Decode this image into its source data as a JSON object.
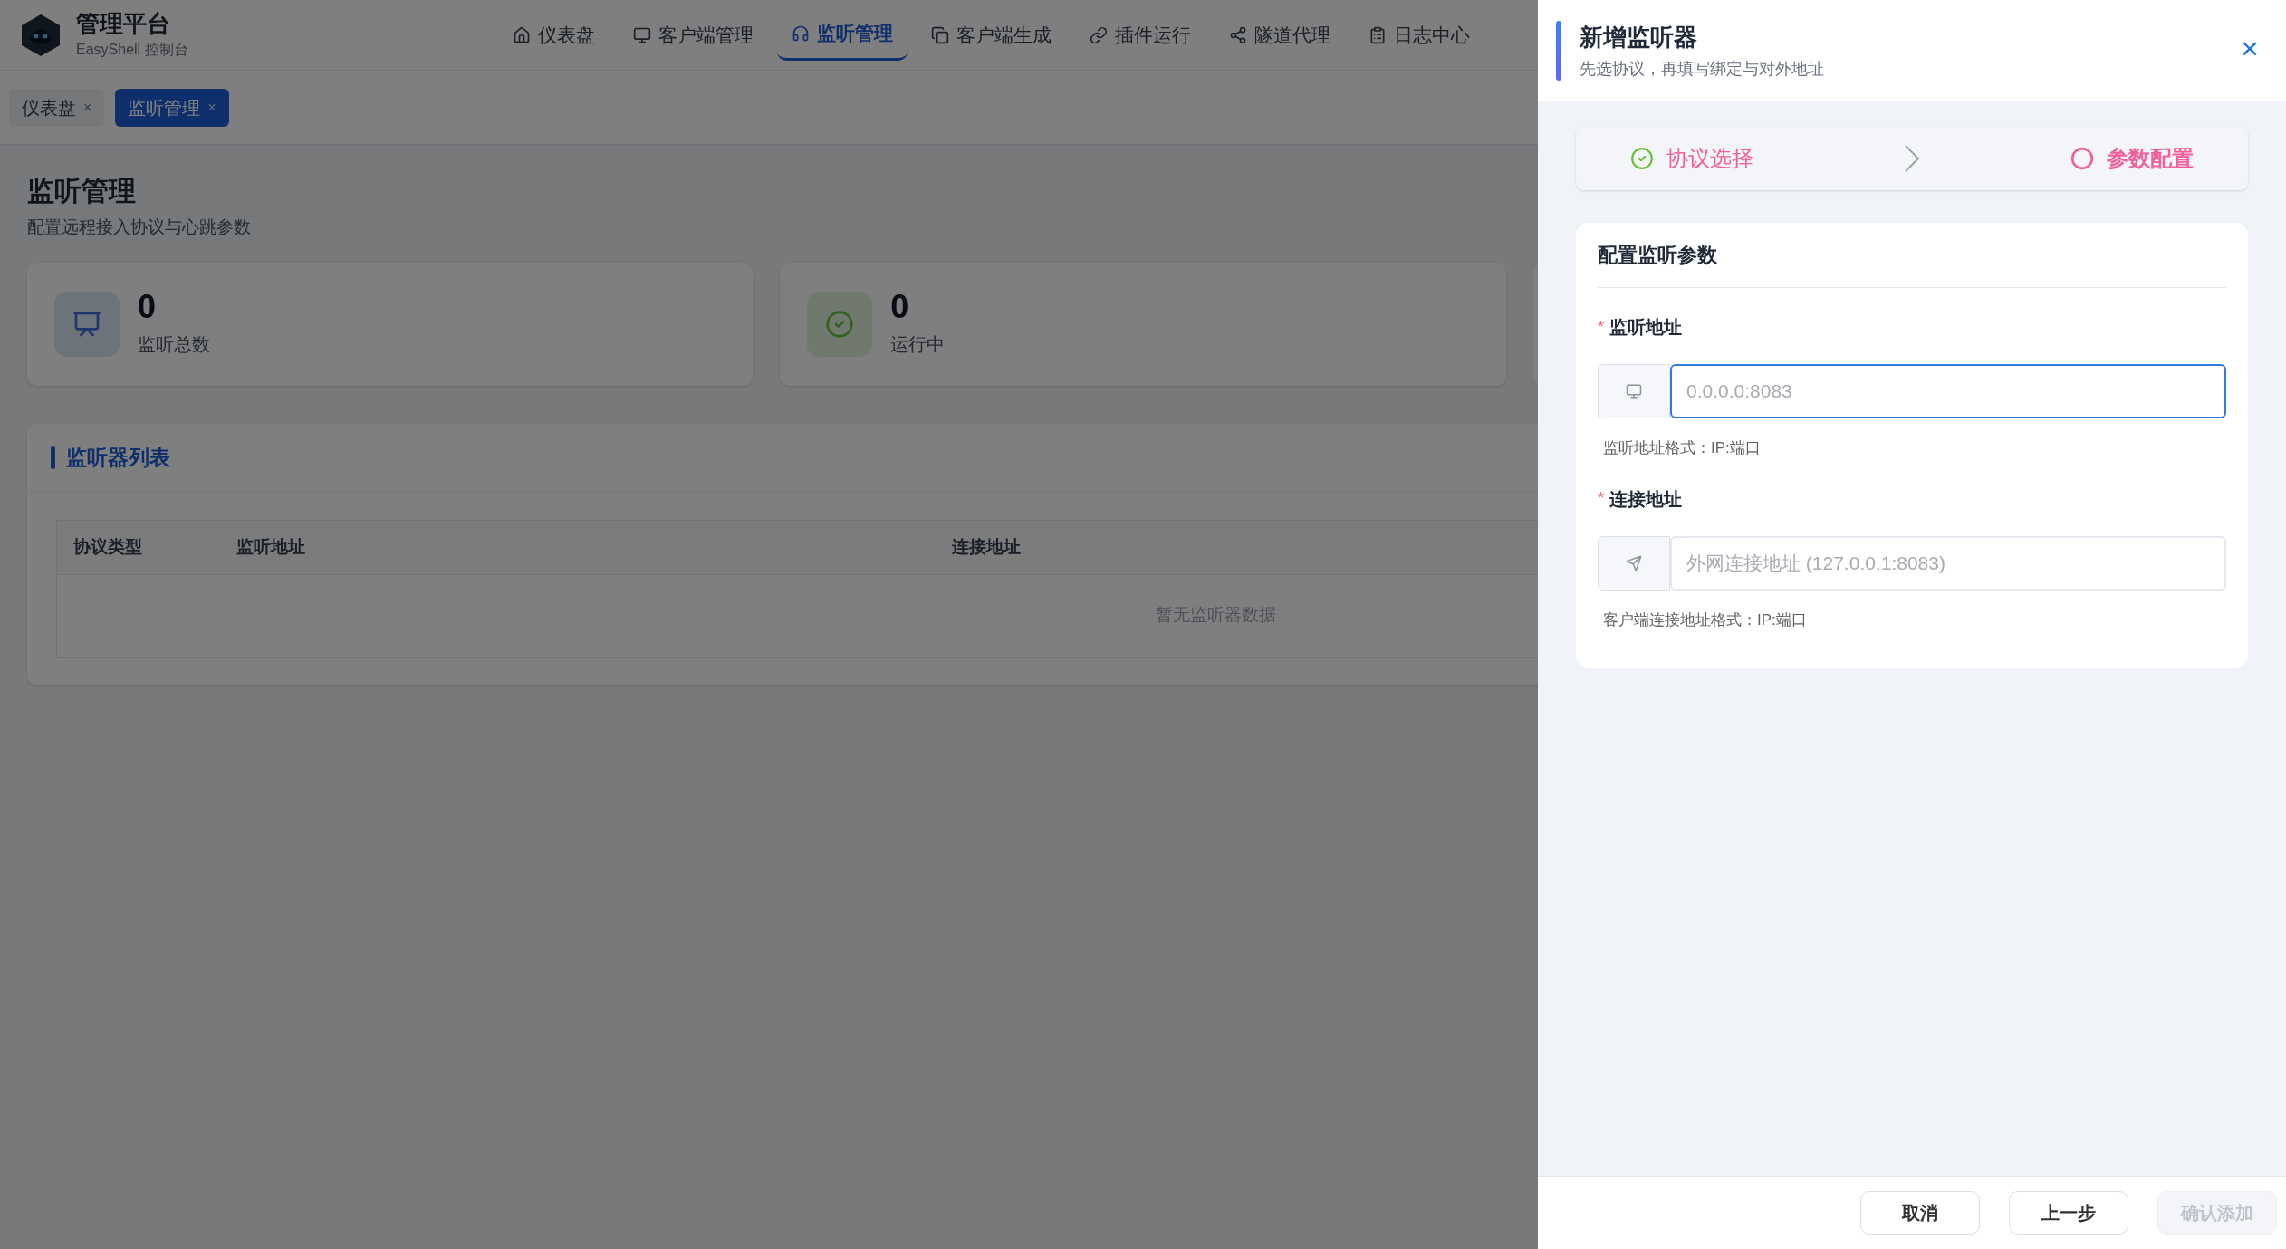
{
  "app": {
    "title": "管理平台",
    "subtitle": "EasyShell 控制台"
  },
  "nav": [
    {
      "label": "仪表盘",
      "selected": false
    },
    {
      "label": "客户端管理",
      "selected": false
    },
    {
      "label": "监听管理",
      "selected": true
    },
    {
      "label": "客户端生成",
      "selected": false
    },
    {
      "label": "插件运行",
      "selected": false
    },
    {
      "label": "隧道代理",
      "selected": false
    },
    {
      "label": "日志中心",
      "selected": false
    }
  ],
  "tags": [
    {
      "label": "仪表盘",
      "close": "×",
      "selected": false
    },
    {
      "label": "监听管理",
      "close": "×",
      "selected": true
    }
  ],
  "page": {
    "title": "监听管理",
    "subtitle": "配置远程接入协议与心跳参数"
  },
  "stats": [
    {
      "value": "0",
      "label": "监听总数"
    },
    {
      "value": "0",
      "label": "运行中"
    }
  ],
  "list": {
    "title": "监听器列表",
    "columns": [
      "协议类型",
      "监听地址",
      "连接地址"
    ],
    "empty": "暂无监听器数据"
  },
  "drawer": {
    "title": "新增监听器",
    "subtitle": "先选协议，再填写绑定与对外地址",
    "close": "×",
    "steps": [
      {
        "label": "协议选择",
        "done": true
      },
      {
        "label": "参数配置",
        "done": false
      }
    ],
    "section": "配置监听参数",
    "fields": [
      {
        "label": "监听地址",
        "required_mark": "*",
        "placeholder": "0.0.0.0:8083",
        "focused": true,
        "hint": "监听地址格式：IP:端口"
      },
      {
        "label": "连接地址",
        "required_mark": "*",
        "placeholder": "外网连接地址 (127.0.0.1:8083)",
        "focused": false,
        "hint": "客户端连接地址格式：IP:端口"
      }
    ],
    "buttons": [
      {
        "label": "取消",
        "disabled": false
      },
      {
        "label": "上一步",
        "disabled": false
      },
      {
        "label": "确认添加",
        "disabled": true
      }
    ]
  }
}
